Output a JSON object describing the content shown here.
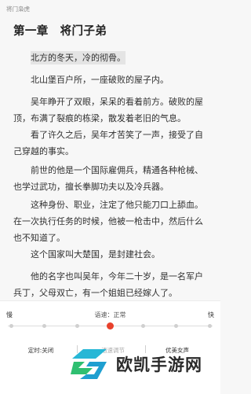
{
  "header": {
    "book_title": "将门枭虎"
  },
  "chapter": {
    "title": "第一章　将门子弟"
  },
  "paragraphs": [
    {
      "text": "北方的冬天，冷的彻骨。"
    },
    {
      "text": "北山堡百户所，一座破败的屋子内。"
    },
    {
      "text": "吴年睁开了双眼，呆呆的看着前方。破败的屋顶，布满了裂痕的栋梁，散发着老旧的气息。"
    },
    {
      "text": "看了许久之后，吴年才苦笑了一声，接受了自己穿越的事实。"
    },
    {
      "text": "前世的他是一个国际雇佣兵，精通各种枪械、也学过武功，擅长拳脚功夫以及冷兵器。"
    },
    {
      "text": "这种身份、职业，注定了他只能刀口上舔血。在一次执行任务的时候，他被一枪击中，然后什么也不知道了。"
    },
    {
      "text": "这个国家叫大楚国，是封建社会。"
    },
    {
      "text": "他的名字也叫吴年，今年二十岁，是一名军户兵丁，父母双亡，有一个姐姐已经嫁人了。"
    }
  ],
  "tts_panel": {
    "slow_label": "慢",
    "fast_label": "快",
    "speed_label": "语速：正常",
    "speed_steps": 7,
    "speed_current_index": 3,
    "accent_color": "#e8412c",
    "options": {
      "timer": "定时:关闭",
      "speed": "语速调节",
      "voice": "优美女声"
    }
  },
  "watermark": {
    "text": "欧凯手游网",
    "icon": "ok-logo-icon"
  }
}
